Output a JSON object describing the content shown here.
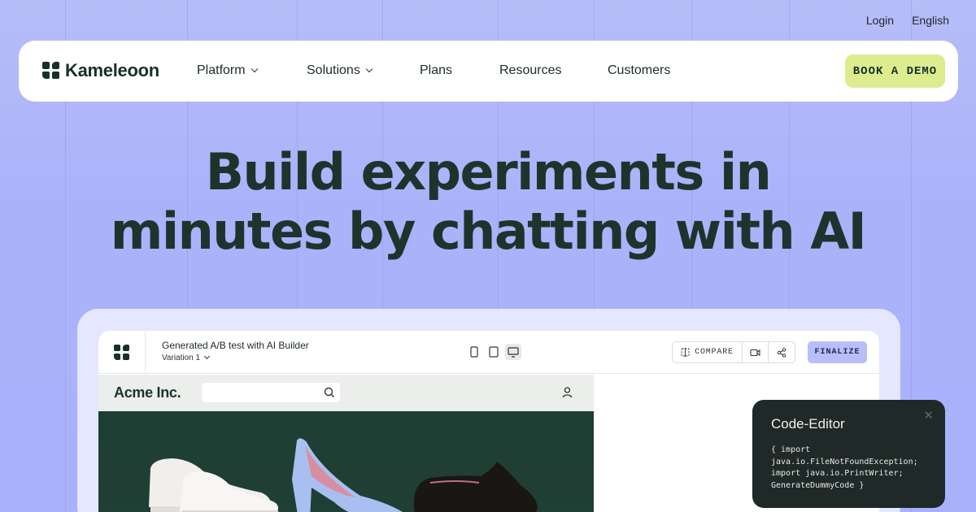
{
  "top_links": {
    "login": "Login",
    "language": "English"
  },
  "nav": {
    "brand": "Kameleoon",
    "items": [
      {
        "label": "Platform",
        "dropdown": true
      },
      {
        "label": "Solutions",
        "dropdown": true
      },
      {
        "label": "Plans",
        "dropdown": false
      },
      {
        "label": "Resources",
        "dropdown": false
      },
      {
        "label": "Customers",
        "dropdown": false
      }
    ],
    "cta": "BOOK A DEMO"
  },
  "hero": {
    "line1": "Build experiments in",
    "line2": "minutes by chatting with AI"
  },
  "app": {
    "title": "Generated A/B test with AI Builder",
    "variation": "Variation 1",
    "devices": [
      "mobile-icon",
      "tablet-icon",
      "desktop-icon"
    ],
    "active_device": "desktop-icon",
    "compare_label": "COMPARE",
    "finalize_label": "FINALIZE"
  },
  "site": {
    "brand": "Acme Inc."
  },
  "code_editor": {
    "title": "Code-Editor",
    "code": "{ import\njava.io.FileNotFoundException;\nimport java.io.PrintWriter;\nGenerateDummyCode }"
  },
  "colors": {
    "background": "#aab2fa",
    "cta": "#dcec8f",
    "finalize": "#b8befa",
    "brand_dark": "#17302a",
    "code_panel": "#1f2927"
  }
}
